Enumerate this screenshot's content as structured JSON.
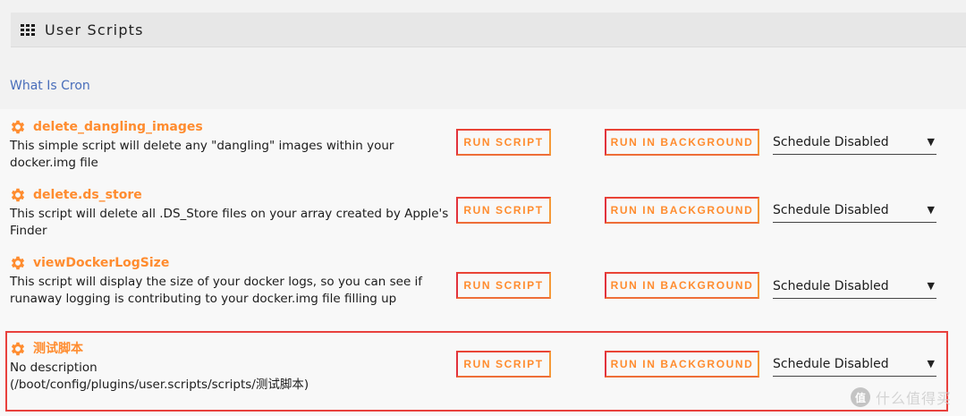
{
  "header": {
    "title": "User Scripts",
    "icon": "grid-icon"
  },
  "cron_link": "What Is Cron",
  "scripts": [
    {
      "name": "delete_dangling_images",
      "desc": "This simple script will delete any \"dangling\" images within your docker.img file",
      "run_label": "RUN SCRIPT",
      "bg_label": "RUN IN BACKGROUND",
      "schedule": "Schedule Disabled"
    },
    {
      "name": "delete.ds_store",
      "desc": "This script will delete all .DS_Store files on your array created by Apple's Finder",
      "run_label": "RUN SCRIPT",
      "bg_label": "RUN IN BACKGROUND",
      "schedule": "Schedule Disabled"
    },
    {
      "name": "viewDockerLogSize",
      "desc": "This script will display the size of your docker logs, so you can see if runaway logging is contributing to your docker.img file filling up",
      "run_label": "RUN SCRIPT",
      "bg_label": "RUN IN BACKGROUND",
      "schedule": "Schedule Disabled"
    },
    {
      "name": "测试脚本",
      "desc": "No description",
      "path": "(/boot/config/plugins/user.scripts/scripts/测试脚本)",
      "run_label": "RUN SCRIPT",
      "bg_label": "RUN IN BACKGROUND",
      "schedule": "Schedule Disabled"
    }
  ],
  "watermark": {
    "badge": "值",
    "text": "什么值得买"
  },
  "colors": {
    "accent": "#ff8c2f",
    "link": "#486dba",
    "highlight": "#e8413d",
    "button_border": "#e2323c"
  }
}
